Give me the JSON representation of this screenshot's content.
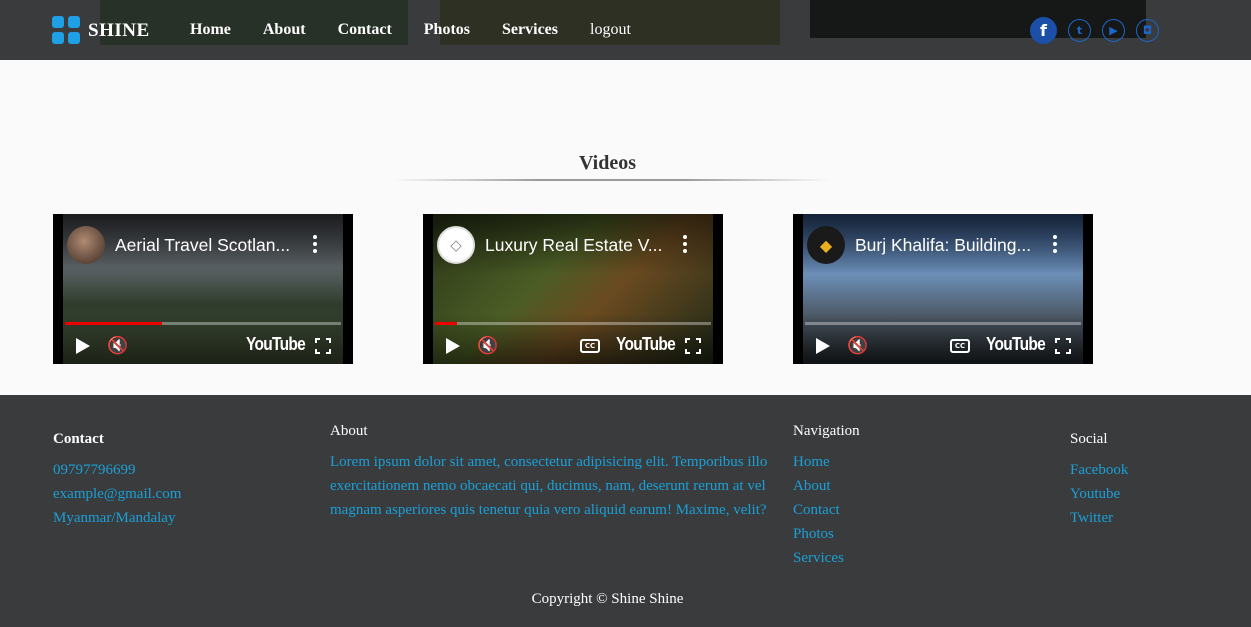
{
  "navbar": {
    "brand": "SHINE",
    "links": [
      "Home",
      "About",
      "Contact",
      "Photos",
      "Services",
      "logout"
    ],
    "social_icons": [
      "facebook-icon",
      "twitter-icon",
      "youtube-icon",
      "instagram-icon"
    ],
    "colors": {
      "background": "#3a3b3c",
      "brand_accent": "#1e9fe6"
    }
  },
  "videos": {
    "title": "Videos",
    "items": [
      {
        "title": "Aerial Travel Scotlan...",
        "progress": 0.35,
        "captions": false
      },
      {
        "title": "Luxury Real Estate V...",
        "progress": 0.08,
        "captions": true
      },
      {
        "title": "Burj Khalifa: Building...",
        "progress": 0.0,
        "captions": true
      }
    ],
    "player_brand": "YouTube"
  },
  "footer": {
    "contact": {
      "heading": "Contact",
      "lines": [
        "09797796699",
        "example@gmail.com",
        "Myanmar/Mandalay"
      ]
    },
    "about": {
      "heading": "About",
      "text": "Lorem ipsum dolor sit amet, consectetur adipisicing elit. Temporibus illo exercitationem nemo obcaecati qui, ducimus, nam, deserunt rerum at vel magnam asperiores quis tenetur quia vero aliquid earum! Maxime, velit?"
    },
    "navigation": {
      "heading": "Navigation",
      "links": [
        "Home",
        "About",
        "Contact",
        "Photos",
        "Services"
      ]
    },
    "social": {
      "heading": "Social",
      "links": [
        "Facebook",
        "Youtube",
        "Twitter"
      ]
    },
    "copyright": "Copyright © Shine Shine",
    "colors": {
      "background": "#3a3b3c",
      "link": "#1aa0d8"
    }
  }
}
